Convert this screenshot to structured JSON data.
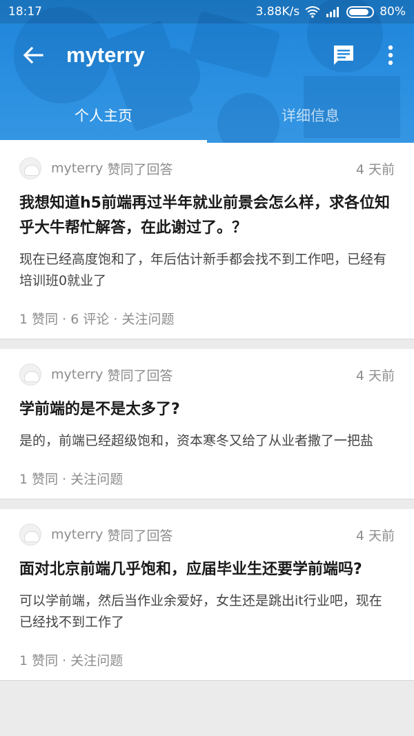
{
  "status_bar": {
    "time": "18:17",
    "speed": "3.88K/s",
    "battery": "80%"
  },
  "toolbar": {
    "title": "myterry",
    "back_icon": "arrow-left-icon",
    "message_icon": "chat-icon",
    "more_icon": "more-vert-icon"
  },
  "tabs": [
    {
      "label": "个人主页",
      "active": true
    },
    {
      "label": "详细信息",
      "active": false
    }
  ],
  "feed": [
    {
      "author": "myterry",
      "action": "赞同了回答",
      "time": "4 天前",
      "title": "我想知道h5前端再过半年就业前景会怎么样，求各位知乎大牛帮忙解答，在此谢过了。？",
      "excerpt": "现在已经高度饱和了，年后估计新手都会找不到工作吧，已经有培训班0就业了",
      "stats": "1 赞同 · 6 评论 · 关注问题"
    },
    {
      "author": "myterry",
      "action": "赞同了回答",
      "time": "4 天前",
      "title": "学前端的是不是太多了?",
      "excerpt": "是的，前端已经超级饱和，资本寒冬又给了从业者撒了一把盐",
      "stats": "1 赞同 · 关注问题"
    },
    {
      "author": "myterry",
      "action": "赞同了回答",
      "time": "4 天前",
      "title": "面对北京前端几乎饱和，应届毕业生还要学前端吗?",
      "excerpt": "可以学前端，然后当作业余爱好，女生还是跳出it行业吧，现在已经找不到工作了",
      "stats": "1 赞同 · 关注问题"
    }
  ],
  "colors": {
    "header_blue": "#2a8fe0",
    "text_dark": "#1a1a1a",
    "text_gray": "#8c8c8c"
  }
}
